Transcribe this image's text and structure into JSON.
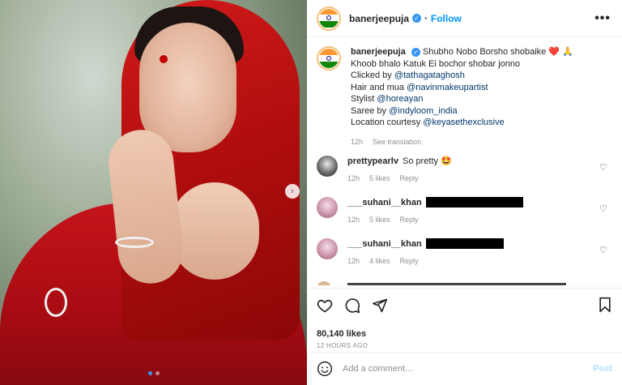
{
  "header": {
    "username": "banerjeepuja",
    "separator": "•",
    "follow_label": "Follow",
    "more_label": "•••"
  },
  "media": {
    "next_label": "›",
    "slide_count": 2,
    "active_slide": 1
  },
  "caption": {
    "username": "banerjeepuja",
    "line1_text": "Shubho Nobo Borsho shobaike",
    "line1_emoji": "❤️ 🙏",
    "line2": "Khoob bhalo Katuk Ei bochor shobar jonno",
    "clicked_prefix": "Clicked by",
    "clicked_mention": "@tathagataghosh",
    "hair_prefix": "Hair and mua",
    "hair_mention": "@navinmakeupartist",
    "stylist_prefix": "Stylist",
    "stylist_mention": "@horeayan",
    "saree_prefix": "Saree by",
    "saree_mention": "@indyloom_india",
    "location_prefix": "Location courtesy",
    "location_mention": "@keyasethexclusive",
    "time": "12h",
    "see_translation": "See translation"
  },
  "comments": [
    {
      "username": "prettypearlv",
      "text": "So pretty 🤩",
      "time": "12h",
      "likes": "5 likes",
      "reply": "Reply"
    },
    {
      "username": "___suhani__khan",
      "text": "",
      "time": "12h",
      "likes": "5 likes",
      "reply": "Reply"
    },
    {
      "username": "___suhani__khan",
      "text": "",
      "time": "12h",
      "likes": "4 likes",
      "reply": "Reply"
    }
  ],
  "actions": {
    "likes": "80,140 likes",
    "timestamp": "12 HOURS AGO"
  },
  "add_comment": {
    "placeholder": "Add a comment…",
    "post_label": "Post"
  },
  "colors": {
    "link_blue": "#0095f6",
    "mention_blue": "#00376b",
    "muted": "#8e8e8e",
    "post_disabled": "#b2dffc"
  }
}
